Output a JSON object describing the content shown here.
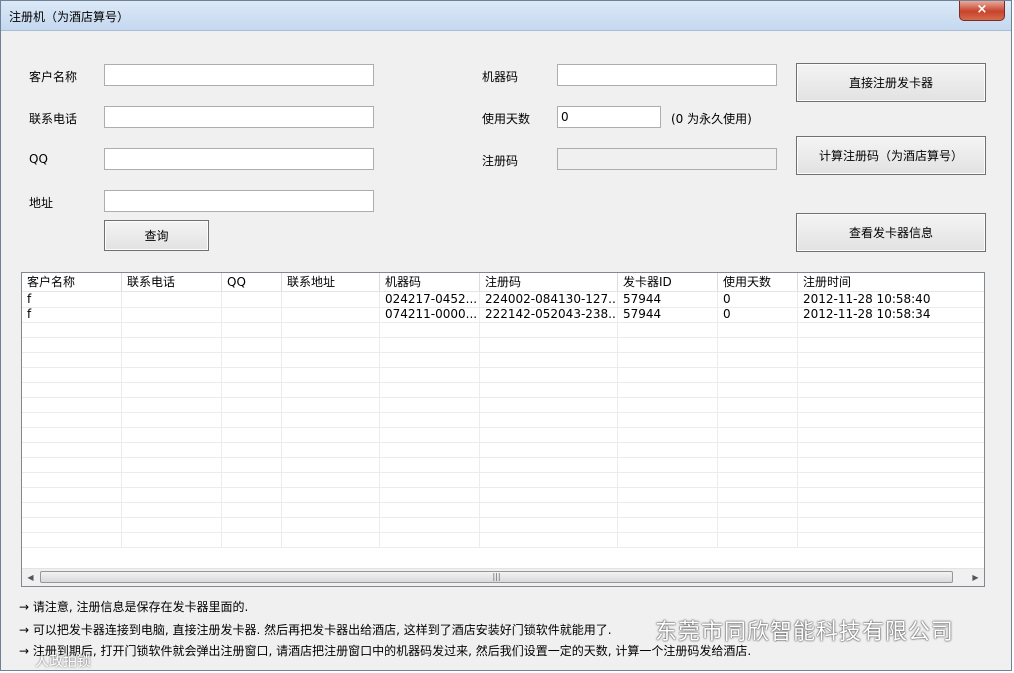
{
  "window": {
    "title": "注册机（为酒店算号）",
    "close_label": "×"
  },
  "form": {
    "customer_name_label": "客户名称",
    "phone_label": "联系电话",
    "qq_label": "QQ",
    "address_label": "地址",
    "machine_code_label": "机器码",
    "days_label": "使用天数",
    "days_value": "0",
    "days_hint": "(0 为永久使用)",
    "reg_code_label": "注册码",
    "customer_name_value": "",
    "phone_value": "",
    "qq_value": "",
    "address_value": "",
    "machine_code_value": "",
    "reg_code_value": ""
  },
  "buttons": {
    "query": "查询",
    "direct_register": "直接注册发卡器",
    "calc_reg_code": "计算注册码（为酒店算号）",
    "view_card_info": "查看发卡器信息"
  },
  "table": {
    "columns": [
      "客户名称",
      "联系电话",
      "QQ",
      "联系地址",
      "机器码",
      "注册码",
      "发卡器ID",
      "使用天数",
      "注册时间"
    ],
    "rows": [
      [
        "f",
        "",
        "",
        "",
        "024217-0452...",
        "224002-084130-127...",
        "57944",
        "0",
        "2012-11-28 10:58:40"
      ],
      [
        "f",
        "",
        "",
        "",
        "074211-0000...",
        "222142-052043-238...",
        "57944",
        "0",
        "2012-11-28 10:58:34"
      ]
    ]
  },
  "notes": [
    "→ 请注意, 注册信息是保存在发卡器里面的.",
    "→ 可以把发卡器连接到电脑, 直接注册发卡器. 然后再把发卡器出给酒店, 这样到了酒店安装好门锁软件就能用了.",
    "→ 注册到期后, 打开门锁软件就会弹出注册窗口, 请酒店把注册窗口中的机器码发过来, 然后我们设置一定的天数, 计算一个注册码发给酒店."
  ],
  "watermarks": {
    "company": "东莞市同欣智能科技有限公司",
    "small": "人政拍锁"
  }
}
